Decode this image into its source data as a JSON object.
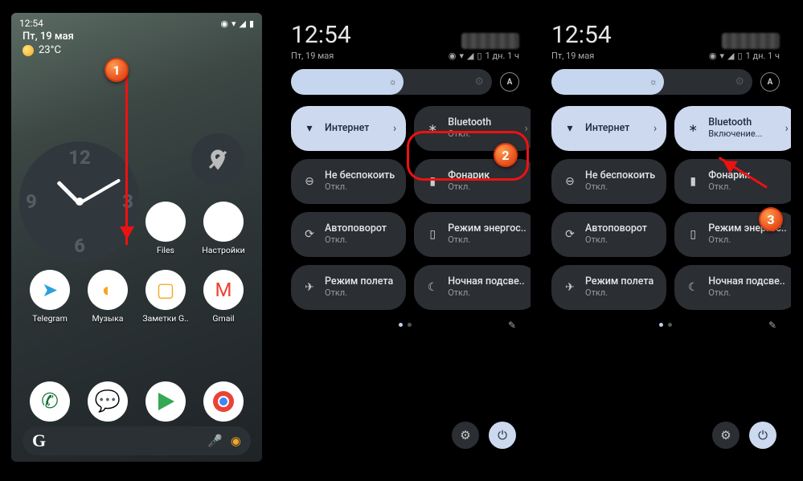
{
  "panel1": {
    "status_time": "12:54",
    "date": "Пт, 19 мая",
    "temp": "23°C",
    "apps_row1": [
      {
        "label": "Files",
        "key": "files"
      },
      {
        "label": "Настройки",
        "key": "settings"
      }
    ],
    "apps_row2": [
      {
        "label": "Telegram",
        "key": "tg"
      },
      {
        "label": "Музыка",
        "key": "music"
      },
      {
        "label": "Заметки G..",
        "key": "keep"
      },
      {
        "label": "Gmail",
        "key": "gmail"
      }
    ],
    "search_letter": "G"
  },
  "qs_common": {
    "time": "12:54",
    "date": "Пт, 19 мая",
    "battery_text": "1 дн. 1 ч",
    "auto_label": "A"
  },
  "panel2_tiles": [
    {
      "title": "Интернет",
      "sub": "",
      "icon": "wifi",
      "on": true,
      "chev": true
    },
    {
      "title": "Bluetooth",
      "sub": "Откл.",
      "icon": "bt",
      "on": false,
      "chev": true
    },
    {
      "title": "Не беспокоить",
      "sub": "Откл.",
      "icon": "dnd",
      "on": false
    },
    {
      "title": "Фонарик",
      "sub": "Откл.",
      "icon": "flash",
      "on": false
    },
    {
      "title": "Автоповорот",
      "sub": "Откл.",
      "icon": "rot",
      "on": false
    },
    {
      "title": "Режим энергос..",
      "sub": "Откл.",
      "icon": "bat",
      "on": false
    },
    {
      "title": "Режим полета",
      "sub": "Откл.",
      "icon": "plane",
      "on": false
    },
    {
      "title": "Ночная подсве..",
      "sub": "Откл.",
      "icon": "night",
      "on": false
    }
  ],
  "panel3_tiles": [
    {
      "title": "Интернет",
      "sub": "",
      "icon": "wifi",
      "on": true,
      "chev": true
    },
    {
      "title": "Bluetooth",
      "sub": "Включение...",
      "icon": "bt",
      "on": true,
      "chev": true
    },
    {
      "title": "Не беспокоить",
      "sub": "Откл.",
      "icon": "dnd",
      "on": false
    },
    {
      "title": "Фонарик",
      "sub": "Откл.",
      "icon": "flash",
      "on": false
    },
    {
      "title": "Автоповорот",
      "sub": "Откл.",
      "icon": "rot",
      "on": false
    },
    {
      "title": "Режим энергос..",
      "sub": "Откл.",
      "icon": "bat",
      "on": false
    },
    {
      "title": "Режим полета",
      "sub": "Откл.",
      "icon": "plane",
      "on": false
    },
    {
      "title": "Ночная подсве..",
      "sub": "Откл.",
      "icon": "night",
      "on": false
    }
  ],
  "badges": {
    "b1": "1",
    "b2": "2",
    "b3": "3"
  },
  "icon_glyph": {
    "wifi": "▾",
    "bt": "∗",
    "dnd": "⊖",
    "flash": "▮",
    "rot": "⟳",
    "bat": "▯",
    "plane": "✈",
    "night": "☾",
    "gear": "⚙",
    "power": "⏻",
    "pen": "✎",
    "mic": "🎤",
    "lens": "◉"
  }
}
